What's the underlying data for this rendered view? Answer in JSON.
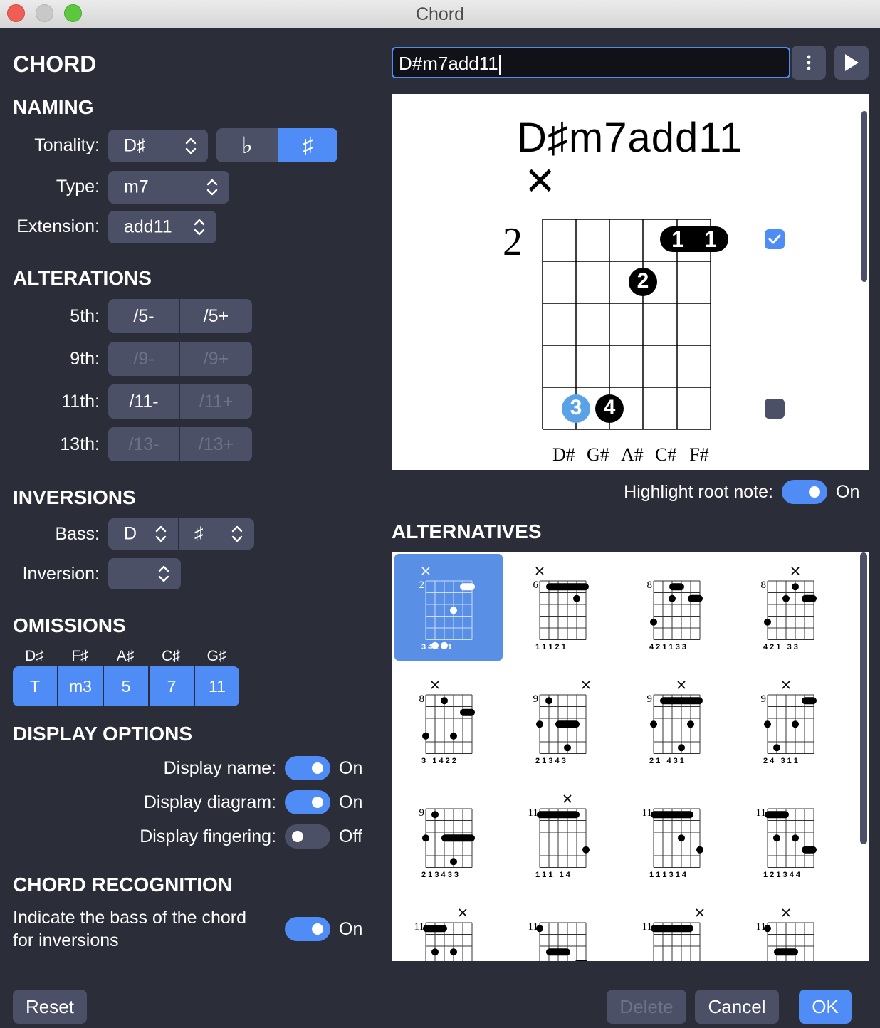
{
  "window": {
    "title": "Chord"
  },
  "sections": {
    "chord": "CHORD",
    "naming": "NAMING",
    "alterations": "ALTERATIONS",
    "inversions": "INVERSIONS",
    "omissions": "OMISSIONS",
    "display_options": "DISPLAY OPTIONS",
    "chord_recognition": "CHORD RECOGNITION",
    "alternatives": "ALTERNATIVES"
  },
  "naming": {
    "tonality_label": "Tonality:",
    "tonality_value": "D♯",
    "flat_symbol": "♭",
    "sharp_symbol": "♯",
    "type_label": "Type:",
    "type_value": "m7",
    "extension_label": "Extension:",
    "extension_value": "add11"
  },
  "alterations": [
    {
      "label": "5th:",
      "minus": "/5-",
      "plus": "/5+",
      "minus_enabled": true,
      "plus_enabled": true
    },
    {
      "label": "9th:",
      "minus": "/9-",
      "plus": "/9+",
      "minus_enabled": false,
      "plus_enabled": false
    },
    {
      "label": "11th:",
      "minus": "/11-",
      "plus": "/11+",
      "minus_enabled": true,
      "plus_enabled": false
    },
    {
      "label": "13th:",
      "minus": "/13-",
      "plus": "/13+",
      "minus_enabled": false,
      "plus_enabled": false
    }
  ],
  "inversions": {
    "bass_label": "Bass:",
    "bass_note": "D",
    "bass_accidental": "♯",
    "inversion_label": "Inversion:",
    "inversion_value": ""
  },
  "omissions": {
    "notes": [
      "D♯",
      "F♯",
      "A♯",
      "C♯",
      "G♯"
    ],
    "buttons": [
      "T",
      "m3",
      "5",
      "7",
      "11"
    ]
  },
  "display_options": {
    "display_name_label": "Display name:",
    "display_name_value": "On",
    "display_diagram_label": "Display diagram:",
    "display_diagram_value": "On",
    "display_fingering_label": "Display fingering:",
    "display_fingering_value": "Off"
  },
  "chord_recognition": {
    "line1": "Indicate the bass of the chord",
    "line2": "for inversions",
    "value": "On"
  },
  "chord_field": {
    "value": "D#m7add11"
  },
  "diagram": {
    "title": "D♯m7add11",
    "muted_symbol": "✕",
    "fret_number": "2",
    "notes": [
      "D#",
      "G#",
      "A#",
      "C#",
      "F#"
    ],
    "fingers": {
      "barre_left": "1",
      "barre_right": "1",
      "f2": "2",
      "f3": "3",
      "f4": "4"
    }
  },
  "highlight_root": {
    "label": "Highlight root note:",
    "value": "On"
  },
  "alternatives": [
    {
      "fret": "2",
      "fingering": "3 4 2 1 1"
    },
    {
      "fret": "6",
      "fingering": "1 1 1 2 1"
    },
    {
      "fret": "8",
      "fingering": "4 2 1 1 3 3"
    },
    {
      "fret": "8",
      "fingering": "4 2 1   3 3"
    },
    {
      "fret": "8",
      "fingering": "3   1 4 2 2"
    },
    {
      "fret": "9",
      "fingering": "2 1 3 4 3"
    },
    {
      "fret": "9",
      "fingering": "2 1   4 3 1"
    },
    {
      "fret": "9",
      "fingering": "2 4   3 1 1"
    },
    {
      "fret": "9",
      "fingering": "2 1 3 4 3 3"
    },
    {
      "fret": "11",
      "fingering": "1 1 1   1 4"
    },
    {
      "fret": "11",
      "fingering": "1 1 1 3 1 4"
    },
    {
      "fret": "11",
      "fingering": "1 2 1 3 4 4"
    },
    {
      "fret": "11",
      "fingering": ""
    },
    {
      "fret": "11",
      "fingering": ""
    },
    {
      "fret": "11",
      "fingering": ""
    },
    {
      "fret": "11",
      "fingering": ""
    }
  ],
  "buttons": {
    "reset": "Reset",
    "delete": "Delete",
    "cancel": "Cancel",
    "ok": "OK"
  },
  "colors": {
    "accent": "#4f8cf6",
    "panel": "#2b2d39",
    "control": "#4b5066"
  }
}
